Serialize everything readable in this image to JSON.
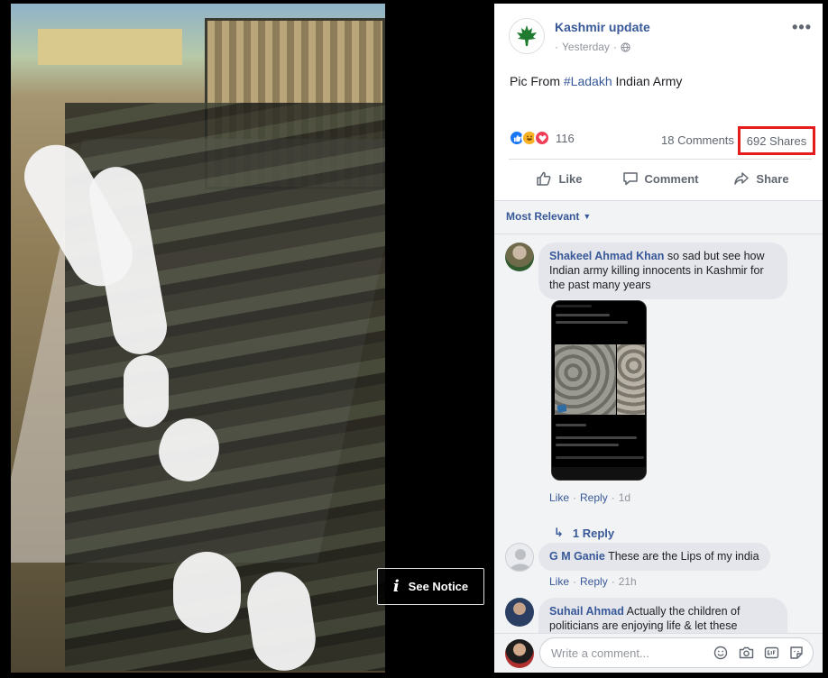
{
  "post": {
    "page_name": "Kashmir update",
    "time": "Yesterday",
    "privacy_icon": "globe-icon",
    "text_before": "Pic From ",
    "hashtag": "#Ladakh",
    "text_after": " Indian Army",
    "reaction_icons": [
      "like-icon",
      "haha-icon",
      "love-icon"
    ],
    "reaction_count": "116",
    "comments_count": "18 Comments",
    "shares_count": "692 Shares",
    "highlight_color": "#e41c1c"
  },
  "actions": {
    "like": "Like",
    "comment": "Comment",
    "share": "Share"
  },
  "viewer": {
    "see_notice": "See Notice"
  },
  "comments": {
    "sort_label": "Most Relevant",
    "items": [
      {
        "author": "Shakeel Ahmad Khan",
        "text": " so sad but see how Indian army killing innocents in Kashmir for the past many years",
        "like": "Like",
        "reply": "Reply",
        "time": "1d",
        "replies_label": "1 Reply"
      },
      {
        "author": "G M Ganie",
        "text": " These are the Lips of my india",
        "like": "Like",
        "reply": "Reply",
        "time": "21h"
      },
      {
        "author": "Suhail Ahmad",
        "text": " Actually the children of politicians are enjoying life & let these"
      }
    ],
    "write_placeholder": "Write a comment..."
  },
  "colors": {
    "link": "#385898",
    "meta": "#90949c"
  }
}
